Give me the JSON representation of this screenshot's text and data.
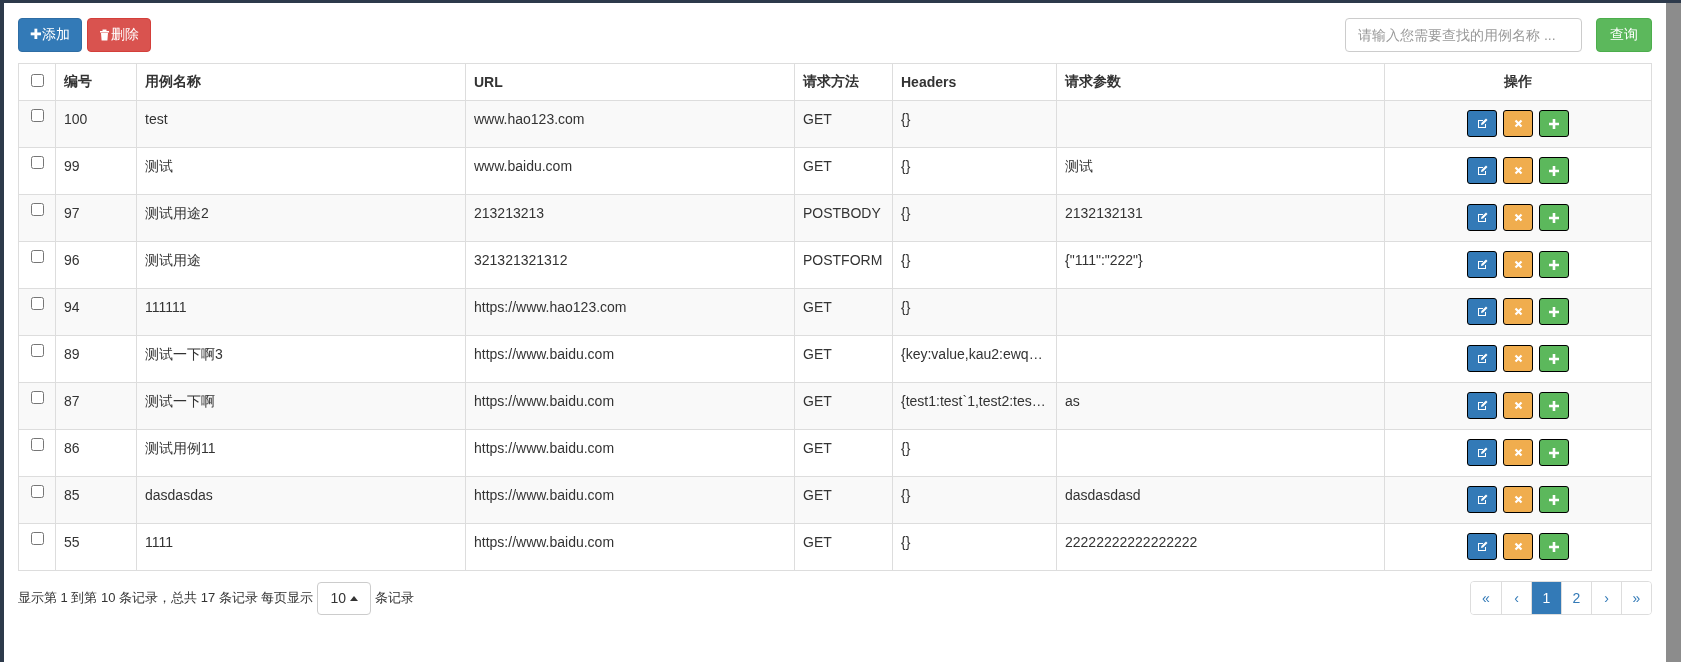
{
  "toolbar": {
    "add_button": "✚添加",
    "delete_button": "删除",
    "search": {
      "placeholder": "请输入您需要查找的用例名称 ..."
    },
    "search_button": "查询"
  },
  "table": {
    "select_all": {
      "checked": false
    },
    "columns": [
      "编号",
      "用例名称",
      "URL",
      "请求方法",
      "Headers",
      "请求参数",
      "操作"
    ],
    "rows": [
      {
        "checked": false,
        "id": "100",
        "name": "test",
        "url": "www.hao123.com",
        "method": "GET",
        "headers": "{}",
        "params": ""
      },
      {
        "checked": false,
        "id": "99",
        "name": "测试",
        "url": "www.baidu.com",
        "method": "GET",
        "headers": "{}",
        "params": "测试"
      },
      {
        "checked": false,
        "id": "97",
        "name": "测试用途2",
        "url": "213213213",
        "method": "POSTBODY",
        "headers": "{}",
        "params": "2132132131"
      },
      {
        "checked": false,
        "id": "96",
        "name": "测试用途",
        "url": "321321321312",
        "method": "POSTFORM",
        "headers": "{}",
        "params": "{\"111\":\"222\"}"
      },
      {
        "checked": false,
        "id": "94",
        "name": "111111",
        "url": "https://www.hao123.com",
        "method": "GET",
        "headers": "{}",
        "params": ""
      },
      {
        "checked": false,
        "id": "89",
        "name": "测试一下啊3",
        "url": "https://www.baidu.com",
        "method": "GET",
        "headers": "{key:value,kau2:ewq…",
        "params": ""
      },
      {
        "checked": false,
        "id": "87",
        "name": "测试一下啊",
        "url": "https://www.baidu.com",
        "method": "GET",
        "headers": "{test1:test`1,test2:tes…",
        "params": "as"
      },
      {
        "checked": false,
        "id": "86",
        "name": "测试用例11",
        "url": "https://www.baidu.com",
        "method": "GET",
        "headers": "{}",
        "params": ""
      },
      {
        "checked": false,
        "id": "85",
        "name": "dasdasdas",
        "url": "https://www.baidu.com",
        "method": "GET",
        "headers": "{}",
        "params": "dasdasdasd"
      },
      {
        "checked": false,
        "id": "55",
        "name": "1111",
        "url": "https://www.baidu.com",
        "method": "GET",
        "headers": "{}",
        "params": "22222222222222222"
      }
    ]
  },
  "footer": {
    "summary": "显示第 1 到第 10 条记录，总共 17 条记录 每页显示",
    "page_size": "10",
    "suffix": "条记录"
  },
  "pagination": [
    {
      "label": "«",
      "selected": false
    },
    {
      "label": "‹",
      "selected": false
    },
    {
      "label": "1",
      "selected": true
    },
    {
      "label": "2",
      "selected": false
    },
    {
      "label": "›",
      "selected": false
    },
    {
      "label": "»",
      "selected": false
    }
  ]
}
